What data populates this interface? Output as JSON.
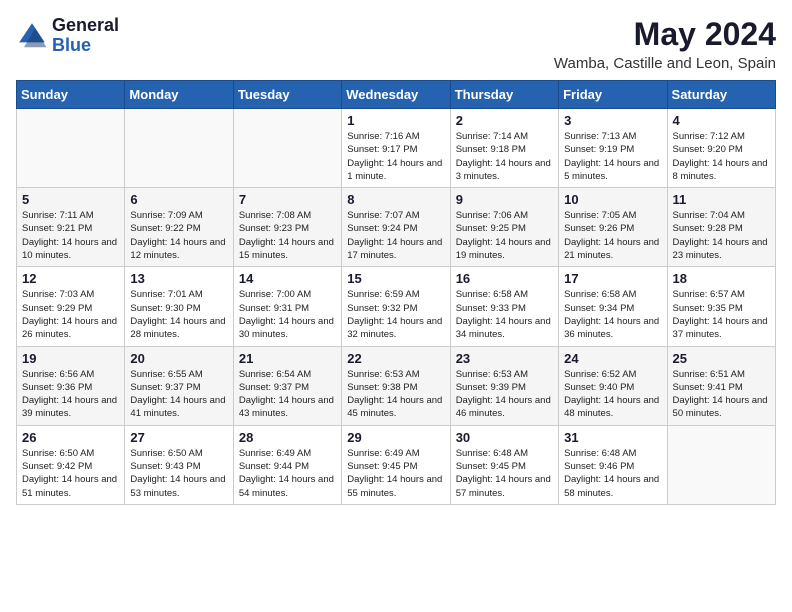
{
  "logo": {
    "general": "General",
    "blue": "Blue"
  },
  "title": {
    "month_year": "May 2024",
    "location": "Wamba, Castille and Leon, Spain"
  },
  "weekdays": [
    "Sunday",
    "Monday",
    "Tuesday",
    "Wednesday",
    "Thursday",
    "Friday",
    "Saturday"
  ],
  "weeks": [
    [
      {
        "day": "",
        "sunrise": "",
        "sunset": "",
        "daylight": ""
      },
      {
        "day": "",
        "sunrise": "",
        "sunset": "",
        "daylight": ""
      },
      {
        "day": "",
        "sunrise": "",
        "sunset": "",
        "daylight": ""
      },
      {
        "day": "1",
        "sunrise": "Sunrise: 7:16 AM",
        "sunset": "Sunset: 9:17 PM",
        "daylight": "Daylight: 14 hours and 1 minute."
      },
      {
        "day": "2",
        "sunrise": "Sunrise: 7:14 AM",
        "sunset": "Sunset: 9:18 PM",
        "daylight": "Daylight: 14 hours and 3 minutes."
      },
      {
        "day": "3",
        "sunrise": "Sunrise: 7:13 AM",
        "sunset": "Sunset: 9:19 PM",
        "daylight": "Daylight: 14 hours and 5 minutes."
      },
      {
        "day": "4",
        "sunrise": "Sunrise: 7:12 AM",
        "sunset": "Sunset: 9:20 PM",
        "daylight": "Daylight: 14 hours and 8 minutes."
      }
    ],
    [
      {
        "day": "5",
        "sunrise": "Sunrise: 7:11 AM",
        "sunset": "Sunset: 9:21 PM",
        "daylight": "Daylight: 14 hours and 10 minutes."
      },
      {
        "day": "6",
        "sunrise": "Sunrise: 7:09 AM",
        "sunset": "Sunset: 9:22 PM",
        "daylight": "Daylight: 14 hours and 12 minutes."
      },
      {
        "day": "7",
        "sunrise": "Sunrise: 7:08 AM",
        "sunset": "Sunset: 9:23 PM",
        "daylight": "Daylight: 14 hours and 15 minutes."
      },
      {
        "day": "8",
        "sunrise": "Sunrise: 7:07 AM",
        "sunset": "Sunset: 9:24 PM",
        "daylight": "Daylight: 14 hours and 17 minutes."
      },
      {
        "day": "9",
        "sunrise": "Sunrise: 7:06 AM",
        "sunset": "Sunset: 9:25 PM",
        "daylight": "Daylight: 14 hours and 19 minutes."
      },
      {
        "day": "10",
        "sunrise": "Sunrise: 7:05 AM",
        "sunset": "Sunset: 9:26 PM",
        "daylight": "Daylight: 14 hours and 21 minutes."
      },
      {
        "day": "11",
        "sunrise": "Sunrise: 7:04 AM",
        "sunset": "Sunset: 9:28 PM",
        "daylight": "Daylight: 14 hours and 23 minutes."
      }
    ],
    [
      {
        "day": "12",
        "sunrise": "Sunrise: 7:03 AM",
        "sunset": "Sunset: 9:29 PM",
        "daylight": "Daylight: 14 hours and 26 minutes."
      },
      {
        "day": "13",
        "sunrise": "Sunrise: 7:01 AM",
        "sunset": "Sunset: 9:30 PM",
        "daylight": "Daylight: 14 hours and 28 minutes."
      },
      {
        "day": "14",
        "sunrise": "Sunrise: 7:00 AM",
        "sunset": "Sunset: 9:31 PM",
        "daylight": "Daylight: 14 hours and 30 minutes."
      },
      {
        "day": "15",
        "sunrise": "Sunrise: 6:59 AM",
        "sunset": "Sunset: 9:32 PM",
        "daylight": "Daylight: 14 hours and 32 minutes."
      },
      {
        "day": "16",
        "sunrise": "Sunrise: 6:58 AM",
        "sunset": "Sunset: 9:33 PM",
        "daylight": "Daylight: 14 hours and 34 minutes."
      },
      {
        "day": "17",
        "sunrise": "Sunrise: 6:58 AM",
        "sunset": "Sunset: 9:34 PM",
        "daylight": "Daylight: 14 hours and 36 minutes."
      },
      {
        "day": "18",
        "sunrise": "Sunrise: 6:57 AM",
        "sunset": "Sunset: 9:35 PM",
        "daylight": "Daylight: 14 hours and 37 minutes."
      }
    ],
    [
      {
        "day": "19",
        "sunrise": "Sunrise: 6:56 AM",
        "sunset": "Sunset: 9:36 PM",
        "daylight": "Daylight: 14 hours and 39 minutes."
      },
      {
        "day": "20",
        "sunrise": "Sunrise: 6:55 AM",
        "sunset": "Sunset: 9:37 PM",
        "daylight": "Daylight: 14 hours and 41 minutes."
      },
      {
        "day": "21",
        "sunrise": "Sunrise: 6:54 AM",
        "sunset": "Sunset: 9:37 PM",
        "daylight": "Daylight: 14 hours and 43 minutes."
      },
      {
        "day": "22",
        "sunrise": "Sunrise: 6:53 AM",
        "sunset": "Sunset: 9:38 PM",
        "daylight": "Daylight: 14 hours and 45 minutes."
      },
      {
        "day": "23",
        "sunrise": "Sunrise: 6:53 AM",
        "sunset": "Sunset: 9:39 PM",
        "daylight": "Daylight: 14 hours and 46 minutes."
      },
      {
        "day": "24",
        "sunrise": "Sunrise: 6:52 AM",
        "sunset": "Sunset: 9:40 PM",
        "daylight": "Daylight: 14 hours and 48 minutes."
      },
      {
        "day": "25",
        "sunrise": "Sunrise: 6:51 AM",
        "sunset": "Sunset: 9:41 PM",
        "daylight": "Daylight: 14 hours and 50 minutes."
      }
    ],
    [
      {
        "day": "26",
        "sunrise": "Sunrise: 6:50 AM",
        "sunset": "Sunset: 9:42 PM",
        "daylight": "Daylight: 14 hours and 51 minutes."
      },
      {
        "day": "27",
        "sunrise": "Sunrise: 6:50 AM",
        "sunset": "Sunset: 9:43 PM",
        "daylight": "Daylight: 14 hours and 53 minutes."
      },
      {
        "day": "28",
        "sunrise": "Sunrise: 6:49 AM",
        "sunset": "Sunset: 9:44 PM",
        "daylight": "Daylight: 14 hours and 54 minutes."
      },
      {
        "day": "29",
        "sunrise": "Sunrise: 6:49 AM",
        "sunset": "Sunset: 9:45 PM",
        "daylight": "Daylight: 14 hours and 55 minutes."
      },
      {
        "day": "30",
        "sunrise": "Sunrise: 6:48 AM",
        "sunset": "Sunset: 9:45 PM",
        "daylight": "Daylight: 14 hours and 57 minutes."
      },
      {
        "day": "31",
        "sunrise": "Sunrise: 6:48 AM",
        "sunset": "Sunset: 9:46 PM",
        "daylight": "Daylight: 14 hours and 58 minutes."
      },
      {
        "day": "",
        "sunrise": "",
        "sunset": "",
        "daylight": ""
      }
    ]
  ]
}
